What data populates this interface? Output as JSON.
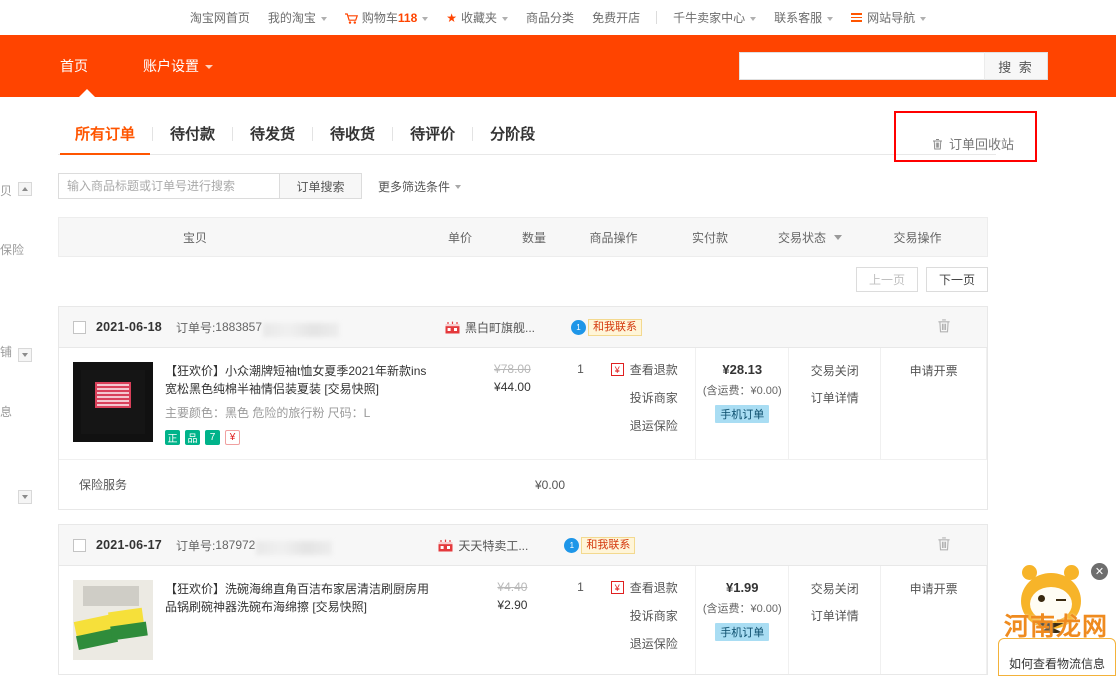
{
  "topnav": {
    "items": [
      {
        "label": "淘宝网首页",
        "caret": false,
        "icon": null
      },
      {
        "label": "我的淘宝",
        "caret": true,
        "icon": null
      },
      {
        "label": "购物车",
        "caret": true,
        "icon": "cart-icon",
        "count": "118"
      },
      {
        "label": "收藏夹",
        "caret": true,
        "icon": "star-icon"
      },
      {
        "label": "商品分类",
        "caret": false,
        "icon": null
      },
      {
        "label": "免费开店",
        "caret": false,
        "icon": null
      },
      {
        "label": "千牛卖家中心",
        "caret": true,
        "icon": null
      },
      {
        "label": "联系客服",
        "caret": true,
        "icon": null
      },
      {
        "label": "网站导航",
        "caret": true,
        "icon": "hamburger-icon"
      }
    ]
  },
  "header": {
    "nav": [
      {
        "label": "首页",
        "caret": false
      },
      {
        "label": "账户设置",
        "caret": true
      }
    ],
    "search": {
      "value": "",
      "placeholder": "",
      "button_label": "搜 索"
    }
  },
  "sidebar": {
    "fragments": [
      "贝",
      "保险",
      "铺",
      "息"
    ]
  },
  "tabs": [
    {
      "label": "所有订单",
      "active": true
    },
    {
      "label": "待付款",
      "active": false
    },
    {
      "label": "待发货",
      "active": false
    },
    {
      "label": "待收货",
      "active": false
    },
    {
      "label": "待评价",
      "active": false
    },
    {
      "label": "分阶段",
      "active": false
    }
  ],
  "recycle": {
    "label": "订单回收站",
    "icon": "trash-icon",
    "highlight_color": "#ff0000"
  },
  "filter": {
    "search_value": "",
    "search_placeholder": "输入商品标题或订单号进行搜索",
    "search_button": "订单搜索",
    "more_label": "更多筛选条件"
  },
  "table": {
    "headers": {
      "product": "宝贝",
      "unit_price": "单价",
      "quantity": "数量",
      "item_ops": "商品操作",
      "paid": "实付款",
      "status": "交易状态",
      "action": "交易操作"
    }
  },
  "pager": {
    "prev": "上一页",
    "next": "下一页"
  },
  "orders": [
    {
      "date": "2021-06-18",
      "order_no_label": "订单号:",
      "order_no": "1883857",
      "shop": "黑白町旗舰...",
      "contact_label": "和我联系",
      "product": {
        "title": "【狂欢价】小众潮牌短袖t恤女夏季2021年新款ins宽松黑色纯棉半袖情侣装夏装 [交易快照]",
        "attrs": "主要颜色：黑色 危险的旅行粉  尺码：L",
        "badges": [
          "正",
          "品",
          "7",
          "¥"
        ]
      },
      "price_old": "¥78.00",
      "price_new": "¥44.00",
      "qty": "1",
      "ops": [
        "查看退款",
        "投诉商家",
        "退运保险"
      ],
      "paid_amount": "¥28.13",
      "paid_ship": "(含运费：¥0.00)",
      "paid_tag": "手机订单",
      "status": [
        "交易关闭",
        "订单详情"
      ],
      "actions": [
        "申请开票"
      ],
      "footer_label": "保险服务",
      "footer_value": "¥0.00"
    },
    {
      "date": "2021-06-17",
      "order_no_label": "订单号:",
      "order_no": "187972",
      "shop": "天天特卖工...",
      "contact_label": "和我联系",
      "product": {
        "title": "【狂欢价】洗碗海绵直角百洁布家居清洁刷厨房用品锅刷碗神器洗碗布海绵擦 [交易快照]",
        "attrs": "",
        "badges": []
      },
      "price_old": "¥4.40",
      "price_new": "¥2.90",
      "qty": "1",
      "ops": [
        "查看退款",
        "投诉商家",
        "退运保险"
      ],
      "paid_amount": "¥1.99",
      "paid_ship": "(含运费：¥0.00)",
      "paid_tag": "手机订单",
      "status": [
        "交易关闭",
        "订单详情"
      ],
      "actions": [
        "申请开票"
      ],
      "footer_label": "",
      "footer_value": ""
    }
  ],
  "chat_widget": {
    "bubble_text": "如何查看物流信息",
    "close_icon": "close-icon"
  },
  "watermark": {
    "text": "河南龙网",
    "color": "#ef8b1f"
  }
}
